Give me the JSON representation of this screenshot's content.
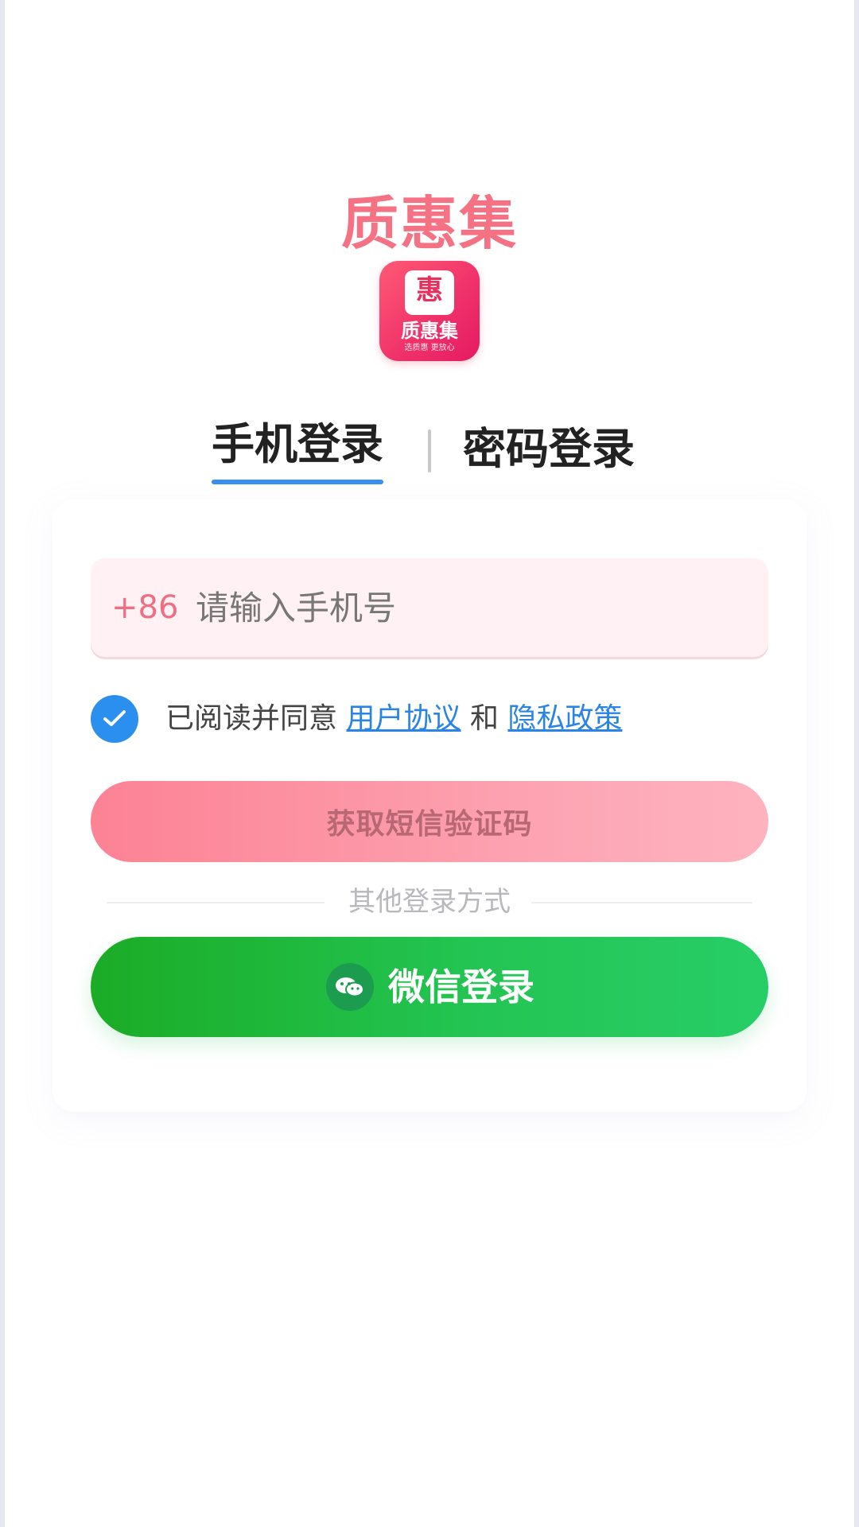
{
  "app": {
    "name": "质惠集",
    "logo": {
      "badge_char": "惠",
      "name": "质惠集",
      "slogan": "选质惠 更放心"
    }
  },
  "tabs": [
    {
      "label": "手机登录",
      "active": true
    },
    {
      "label": "密码登录",
      "active": false
    }
  ],
  "form": {
    "country_code": "+86",
    "phone_value": "",
    "phone_placeholder": "请输入手机号",
    "agreement": {
      "checked": true,
      "prefix": "已阅读并同意",
      "user_agreement": "用户协议",
      "conjunction": "和",
      "privacy_policy": "隐私政策"
    },
    "sms_button_label": "获取短信验证码",
    "other_methods_label": "其他登录方式",
    "wechat_button_label": "微信登录"
  },
  "colors": {
    "brand_pink": "#f47284",
    "tab_underline": "#3a8ff0",
    "link_blue": "#2a84e6",
    "wechat_green": "#23c452"
  },
  "icons": {
    "check": "check-icon",
    "wechat": "wechat-icon"
  }
}
